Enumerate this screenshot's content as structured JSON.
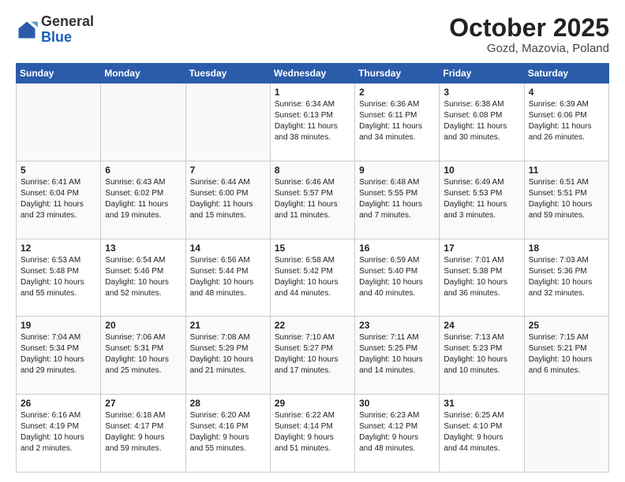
{
  "header": {
    "logo_general": "General",
    "logo_blue": "Blue",
    "title": "October 2025",
    "subtitle": "Gozd, Mazovia, Poland"
  },
  "weekdays": [
    "Sunday",
    "Monday",
    "Tuesday",
    "Wednesday",
    "Thursday",
    "Friday",
    "Saturday"
  ],
  "weeks": [
    [
      {
        "day": "",
        "info": ""
      },
      {
        "day": "",
        "info": ""
      },
      {
        "day": "",
        "info": ""
      },
      {
        "day": "1",
        "info": "Sunrise: 6:34 AM\nSunset: 6:13 PM\nDaylight: 11 hours\nand 38 minutes."
      },
      {
        "day": "2",
        "info": "Sunrise: 6:36 AM\nSunset: 6:11 PM\nDaylight: 11 hours\nand 34 minutes."
      },
      {
        "day": "3",
        "info": "Sunrise: 6:38 AM\nSunset: 6:08 PM\nDaylight: 11 hours\nand 30 minutes."
      },
      {
        "day": "4",
        "info": "Sunrise: 6:39 AM\nSunset: 6:06 PM\nDaylight: 11 hours\nand 26 minutes."
      }
    ],
    [
      {
        "day": "5",
        "info": "Sunrise: 6:41 AM\nSunset: 6:04 PM\nDaylight: 11 hours\nand 23 minutes."
      },
      {
        "day": "6",
        "info": "Sunrise: 6:43 AM\nSunset: 6:02 PM\nDaylight: 11 hours\nand 19 minutes."
      },
      {
        "day": "7",
        "info": "Sunrise: 6:44 AM\nSunset: 6:00 PM\nDaylight: 11 hours\nand 15 minutes."
      },
      {
        "day": "8",
        "info": "Sunrise: 6:46 AM\nSunset: 5:57 PM\nDaylight: 11 hours\nand 11 minutes."
      },
      {
        "day": "9",
        "info": "Sunrise: 6:48 AM\nSunset: 5:55 PM\nDaylight: 11 hours\nand 7 minutes."
      },
      {
        "day": "10",
        "info": "Sunrise: 6:49 AM\nSunset: 5:53 PM\nDaylight: 11 hours\nand 3 minutes."
      },
      {
        "day": "11",
        "info": "Sunrise: 6:51 AM\nSunset: 5:51 PM\nDaylight: 10 hours\nand 59 minutes."
      }
    ],
    [
      {
        "day": "12",
        "info": "Sunrise: 6:53 AM\nSunset: 5:48 PM\nDaylight: 10 hours\nand 55 minutes."
      },
      {
        "day": "13",
        "info": "Sunrise: 6:54 AM\nSunset: 5:46 PM\nDaylight: 10 hours\nand 52 minutes."
      },
      {
        "day": "14",
        "info": "Sunrise: 6:56 AM\nSunset: 5:44 PM\nDaylight: 10 hours\nand 48 minutes."
      },
      {
        "day": "15",
        "info": "Sunrise: 6:58 AM\nSunset: 5:42 PM\nDaylight: 10 hours\nand 44 minutes."
      },
      {
        "day": "16",
        "info": "Sunrise: 6:59 AM\nSunset: 5:40 PM\nDaylight: 10 hours\nand 40 minutes."
      },
      {
        "day": "17",
        "info": "Sunrise: 7:01 AM\nSunset: 5:38 PM\nDaylight: 10 hours\nand 36 minutes."
      },
      {
        "day": "18",
        "info": "Sunrise: 7:03 AM\nSunset: 5:36 PM\nDaylight: 10 hours\nand 32 minutes."
      }
    ],
    [
      {
        "day": "19",
        "info": "Sunrise: 7:04 AM\nSunset: 5:34 PM\nDaylight: 10 hours\nand 29 minutes."
      },
      {
        "day": "20",
        "info": "Sunrise: 7:06 AM\nSunset: 5:31 PM\nDaylight: 10 hours\nand 25 minutes."
      },
      {
        "day": "21",
        "info": "Sunrise: 7:08 AM\nSunset: 5:29 PM\nDaylight: 10 hours\nand 21 minutes."
      },
      {
        "day": "22",
        "info": "Sunrise: 7:10 AM\nSunset: 5:27 PM\nDaylight: 10 hours\nand 17 minutes."
      },
      {
        "day": "23",
        "info": "Sunrise: 7:11 AM\nSunset: 5:25 PM\nDaylight: 10 hours\nand 14 minutes."
      },
      {
        "day": "24",
        "info": "Sunrise: 7:13 AM\nSunset: 5:23 PM\nDaylight: 10 hours\nand 10 minutes."
      },
      {
        "day": "25",
        "info": "Sunrise: 7:15 AM\nSunset: 5:21 PM\nDaylight: 10 hours\nand 6 minutes."
      }
    ],
    [
      {
        "day": "26",
        "info": "Sunrise: 6:16 AM\nSunset: 4:19 PM\nDaylight: 10 hours\nand 2 minutes."
      },
      {
        "day": "27",
        "info": "Sunrise: 6:18 AM\nSunset: 4:17 PM\nDaylight: 9 hours\nand 59 minutes."
      },
      {
        "day": "28",
        "info": "Sunrise: 6:20 AM\nSunset: 4:16 PM\nDaylight: 9 hours\nand 55 minutes."
      },
      {
        "day": "29",
        "info": "Sunrise: 6:22 AM\nSunset: 4:14 PM\nDaylight: 9 hours\nand 51 minutes."
      },
      {
        "day": "30",
        "info": "Sunrise: 6:23 AM\nSunset: 4:12 PM\nDaylight: 9 hours\nand 48 minutes."
      },
      {
        "day": "31",
        "info": "Sunrise: 6:25 AM\nSunset: 4:10 PM\nDaylight: 9 hours\nand 44 minutes."
      },
      {
        "day": "",
        "info": ""
      }
    ]
  ]
}
